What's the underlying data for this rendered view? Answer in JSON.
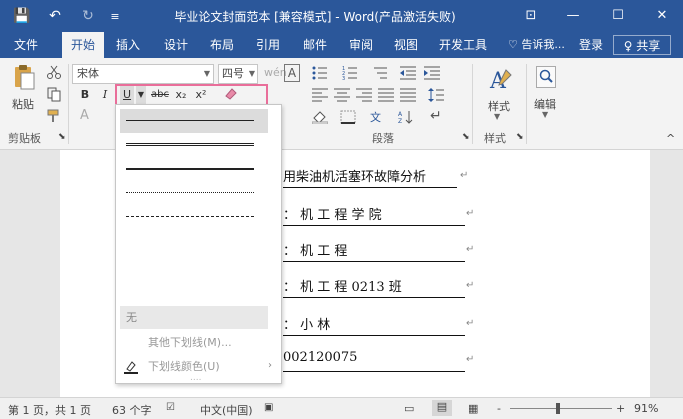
{
  "titlebar": {
    "title": "毕业论文封面范本 [兼容模式] - Word(产品激活失败)",
    "save_icon": "💾",
    "undo_icon": "↶",
    "redo_icon": "↻",
    "customize_icon": "≡",
    "ribbon_opts_icon": "⊡",
    "minimize": "—",
    "restore": "☐",
    "close": "✕"
  },
  "tabs": [
    "文件",
    "开始",
    "插入",
    "设计",
    "布局",
    "引用",
    "邮件",
    "审阅",
    "视图",
    "开发工具"
  ],
  "tellme": "♡ 告诉我...",
  "login": "登录",
  "share": "♀ 共享",
  "ribbon": {
    "paste_label": "粘贴",
    "clipboard_label": "剪贴板",
    "font_name": "宋体",
    "font_size": "四号",
    "bold": "B",
    "italic": "I",
    "underline": "U",
    "strike": "abc",
    "subscript": "x₂",
    "superscript": "x²",
    "paragraph_label": "段落",
    "styles_btn": "样式",
    "styles_label": "样式",
    "edit_btn": "编辑"
  },
  "doc": {
    "line1": "用柴油机活塞环故障分析",
    "line2": "：  机  工  程  学  院",
    "line3": "：  机  工  程",
    "line4": "：  机  工  程    0213 班",
    "line5": "：  小  林",
    "line6": "002120075"
  },
  "dropdown": {
    "none_label": "无",
    "more_underlines": "其他下划线(M)...",
    "underline_color": "下划线颜色(U)",
    "arrow": "›",
    "more": "....",
    "options": [
      {
        "style": "solid",
        "selected": true
      },
      {
        "style": "double",
        "selected": false
      },
      {
        "style": "thick",
        "selected": false
      },
      {
        "style": "dotted",
        "selected": false
      },
      {
        "style": "dashed",
        "selected": false
      },
      {
        "style": "dashdot",
        "selected": false
      },
      {
        "style": "dashdotdot",
        "selected": false
      },
      {
        "style": "wavy",
        "selected": false
      }
    ]
  },
  "status": {
    "page": "第 1 页，共 1 页",
    "words": "63 个字",
    "lang": "中文(中国)",
    "zoom": "91%",
    "zoom_out": "-",
    "zoom_in": "+"
  },
  "colors": {
    "brand": "#2b579a",
    "highlight_border": "#e96e9a"
  }
}
